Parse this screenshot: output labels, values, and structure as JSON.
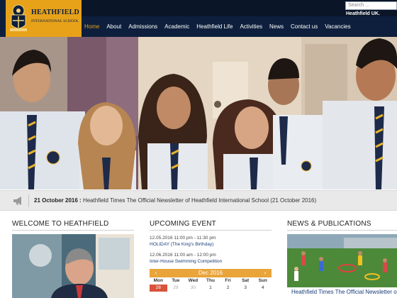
{
  "brand": {
    "name": "HEATHFIELD",
    "subtitle": "INTERNATIONAL SCHOOL",
    "colors": {
      "navy": "#0d1f3c",
      "gold": "#e7a21a"
    }
  },
  "search": {
    "placeholder": "Search ..."
  },
  "region": "Heathfield UK.",
  "nav": {
    "items": [
      {
        "label": "Home",
        "active": true
      },
      {
        "label": "About"
      },
      {
        "label": "Admissions"
      },
      {
        "label": "Academic"
      },
      {
        "label": "Heathfield Life"
      },
      {
        "label": "Activities"
      },
      {
        "label": "News"
      },
      {
        "label": "Contact us"
      },
      {
        "label": "Vacancies"
      }
    ]
  },
  "ticker": {
    "date": "21 October 2016 :",
    "text": "Heathfield Times The Official Newsletter of Heathfield International School (21 October 2016)"
  },
  "welcome": {
    "title": "WELCOME TO HEATHFIELD"
  },
  "events": {
    "title": "UPCOMING EVENT",
    "items": [
      {
        "time": "12.05.2016 11:00 pm - 11:30 pm",
        "name": "HOLIDAY (The King's Birthday)"
      },
      {
        "time": "12.06.2016 11:00 am - 12:00 pm",
        "name": "Inter-House Swimming Competition"
      }
    ]
  },
  "calendar": {
    "month": "Dec 2016",
    "prev": "‹",
    "next": "›",
    "weekdays": [
      "Mon",
      "Tue",
      "Wed",
      "Thu",
      "Fri",
      "Sat",
      "Sun"
    ],
    "row1": [
      "28",
      "29",
      "30",
      "1",
      "2",
      "3",
      "4"
    ]
  },
  "news": {
    "title": "NEWS & PUBLICATIONS",
    "caption": "Heathfield Times The Official Newsletter of"
  }
}
